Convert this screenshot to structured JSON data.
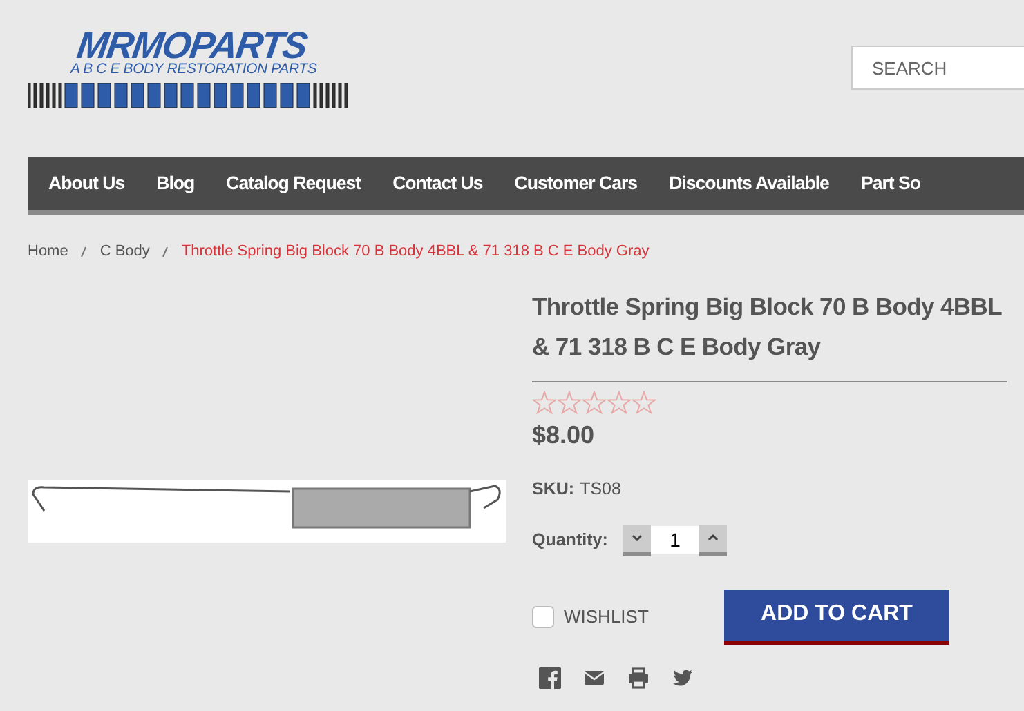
{
  "logo": {
    "title": "MRMOPARTS",
    "subtitle": "A B C E BODY RESTORATION PARTS"
  },
  "search": {
    "placeholder": "SEARCH"
  },
  "nav": [
    "About Us",
    "Blog",
    "Catalog Request",
    "Contact Us",
    "Customer Cars",
    "Discounts Available",
    "Part So"
  ],
  "breadcrumb": [
    {
      "label": "Home",
      "current": false
    },
    {
      "label": "C Body",
      "current": false
    },
    {
      "label": "Throttle Spring Big Block 70 B Body 4BBL & 71 318 B C E Body Gray",
      "current": true
    }
  ],
  "product": {
    "title": "Throttle Spring Big Block 70 B Body 4BBL & 71 318 B C E Body Gray",
    "stars": 0,
    "price": "$8.00",
    "sku_label": "SKU:",
    "sku": "TS08",
    "quantity_label": "Quantity:",
    "quantity": "1",
    "wishlist": {
      "label": "WISHLIST",
      "checked": false
    },
    "add_to_cart": "ADD TO CART"
  },
  "share": [
    {
      "kind": "facebook"
    },
    {
      "kind": "email"
    },
    {
      "kind": "print"
    },
    {
      "kind": "twitter"
    }
  ]
}
